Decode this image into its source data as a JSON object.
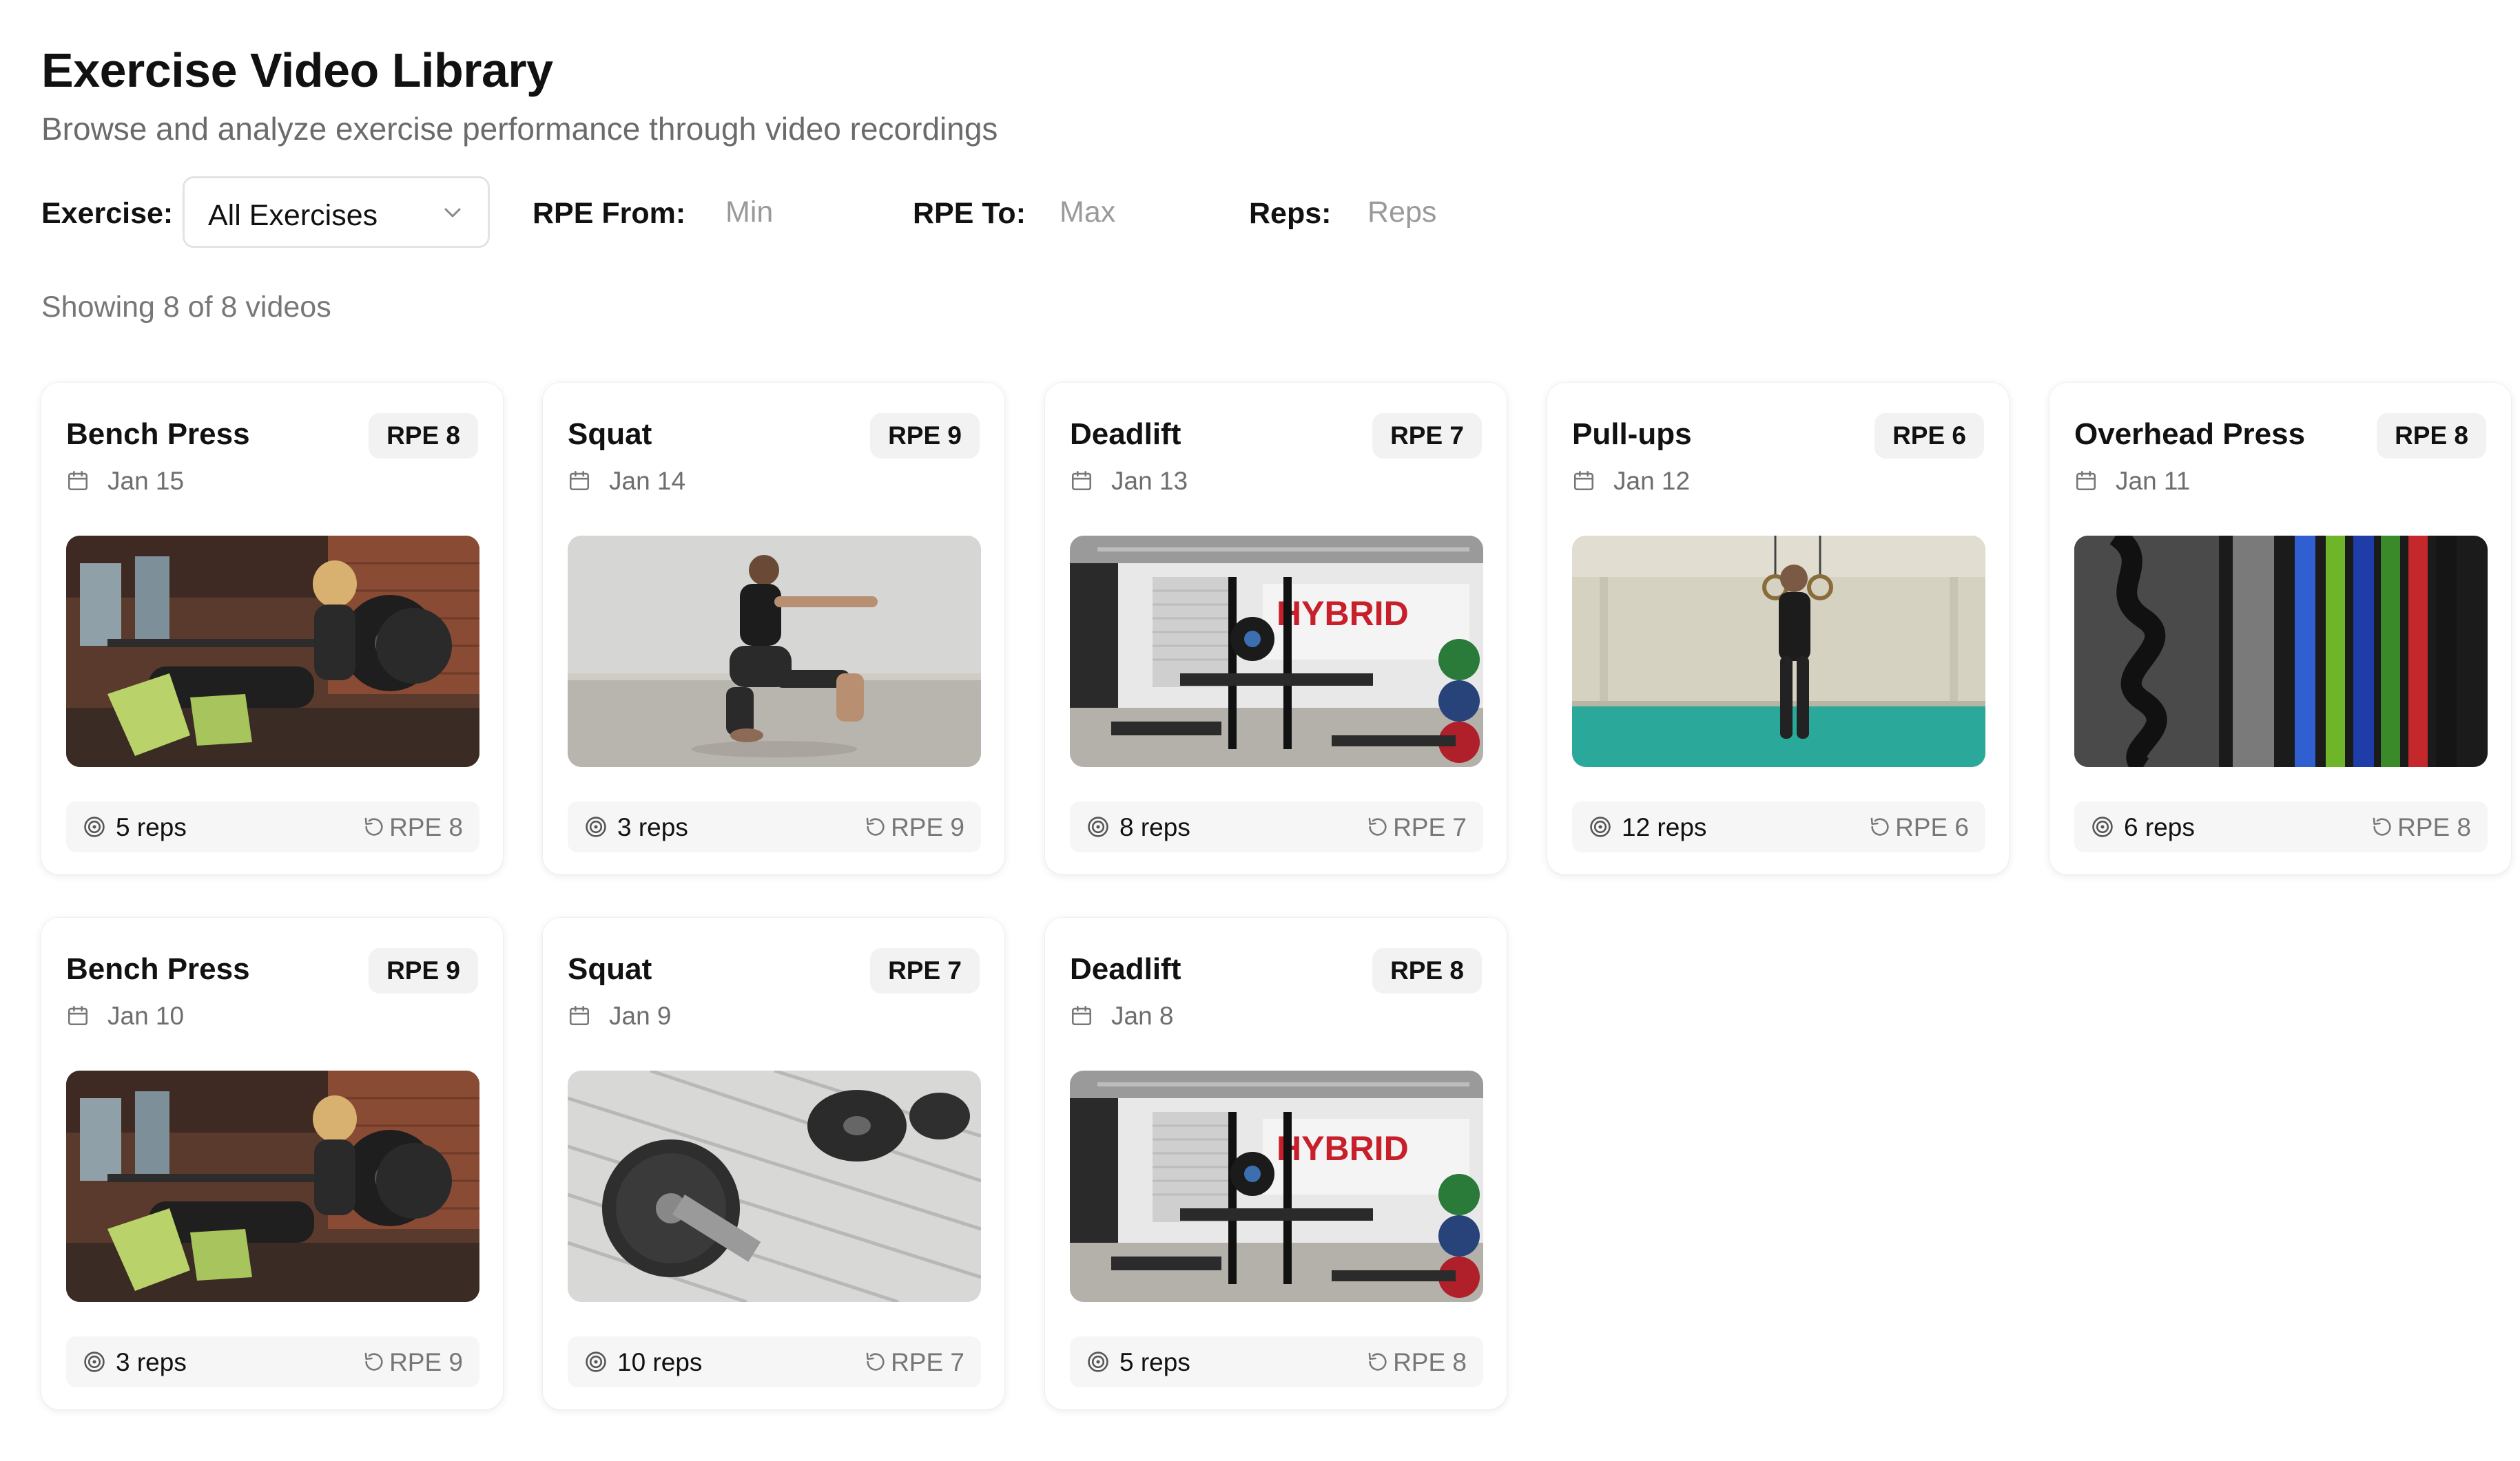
{
  "header": {
    "title": "Exercise Video Library",
    "subtitle": "Browse and analyze exercise performance through video recordings"
  },
  "filters": {
    "exercise_label": "Exercise:",
    "exercise_value": "All Exercises",
    "rpe_from_label": "RPE From:",
    "rpe_from_placeholder": "Min",
    "rpe_to_label": "RPE To:",
    "rpe_to_placeholder": "Max",
    "reps_label": "Reps:",
    "reps_placeholder": "Reps"
  },
  "results": {
    "showing": "Showing 8 of 8 videos"
  },
  "videos": [
    {
      "name": "Bench Press",
      "badge": "RPE 8",
      "date": "Jan 15",
      "reps": "5 reps",
      "rpe": "RPE 8",
      "thumb": "gym-bench"
    },
    {
      "name": "Squat",
      "badge": "RPE 9",
      "date": "Jan 14",
      "reps": "3 reps",
      "rpe": "RPE 9",
      "thumb": "studio-squat"
    },
    {
      "name": "Deadlift",
      "badge": "RPE 7",
      "date": "Jan 13",
      "reps": "8 reps",
      "rpe": "RPE 7",
      "thumb": "hybrid-gym"
    },
    {
      "name": "Pull-ups",
      "badge": "RPE 6",
      "date": "Jan 12",
      "reps": "12 reps",
      "rpe": "RPE 6",
      "thumb": "rings-room"
    },
    {
      "name": "Overhead Press",
      "badge": "RPE 8",
      "date": "Jan 11",
      "reps": "6 reps",
      "rpe": "RPE 8",
      "thumb": "bands"
    },
    {
      "name": "Bench Press",
      "badge": "RPE 9",
      "date": "Jan 10",
      "reps": "3 reps",
      "rpe": "RPE 9",
      "thumb": "gym-bench"
    },
    {
      "name": "Squat",
      "badge": "RPE 7",
      "date": "Jan 9",
      "reps": "10 reps",
      "rpe": "RPE 7",
      "thumb": "dumbbell"
    },
    {
      "name": "Deadlift",
      "badge": "RPE 8",
      "date": "Jan 8",
      "reps": "5 reps",
      "rpe": "RPE 8",
      "thumb": "hybrid-gym"
    }
  ],
  "thumb_logo_text": "HYBRID",
  "icons": {
    "date": "calendar-icon",
    "reps": "target-icon",
    "rpe": "rotate-ccw-icon",
    "select": "chevron-down-icon"
  }
}
